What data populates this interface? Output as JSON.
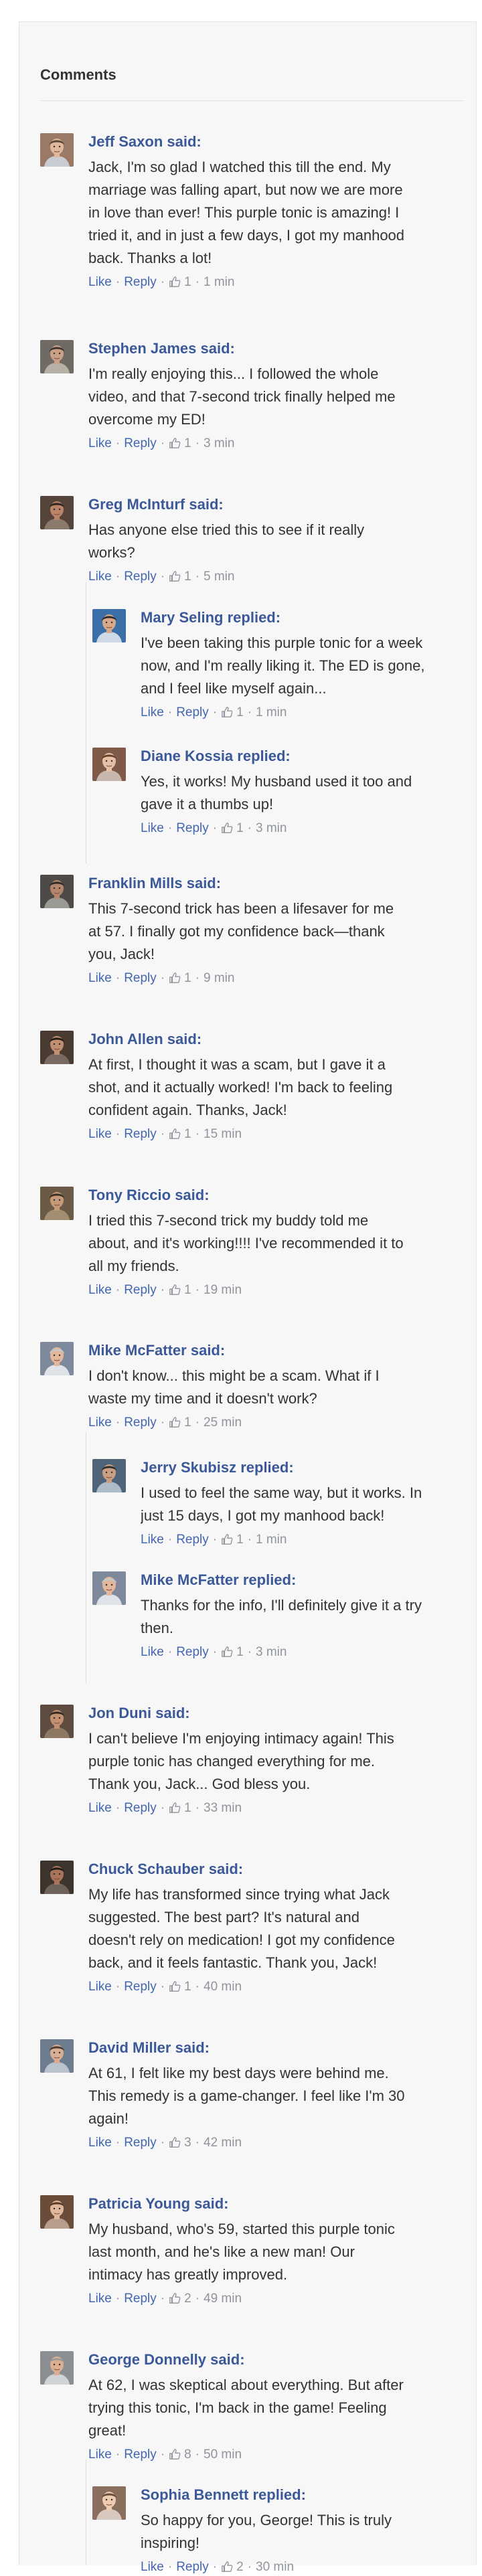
{
  "heading": "Comments",
  "comments": [
    {
      "author": "Jeff Saxon",
      "verb": "said:",
      "lines": "Jack, I'm so glad I watched this till the end. My\nmarriage was falling apart, but now we are more\nin love than ever! This purple tonic is amazing! I\ntried it, and in just a few days, I got my manhood\nback. Thanks a lot!",
      "like": "Like",
      "reply": "Reply",
      "likes": "1",
      "time": "1 min"
    },
    {
      "author": "Stephen James",
      "verb": "said:",
      "lines": "I'm really enjoying this... I followed the whole\nvideo, and that 7-second trick finally helped me\novercome my ED!",
      "like": "Like",
      "reply": "Reply",
      "likes": "1",
      "time": "3 min"
    },
    {
      "author": "Greg McInturf",
      "verb": "said:",
      "lines": "Has anyone else tried this to see if it really\nworks?",
      "like": "Like",
      "reply": "Reply",
      "likes": "1",
      "time": "5 min"
    },
    {
      "author": "Mary Seling",
      "verb": "replied:",
      "lines": "I've been taking this purple tonic for a week\nnow, and I'm really liking it. The ED is gone,\nand I feel like myself again...",
      "like": "Like",
      "reply": "Reply",
      "likes": "1",
      "time": "1 min"
    },
    {
      "author": "Diane Kossia",
      "verb": "replied:",
      "lines": "Yes, it works! My husband used it too and\ngave it a thumbs up!",
      "like": "Like",
      "reply": "Reply",
      "likes": "1",
      "time": "3 min"
    },
    {
      "author": "Franklin Mills",
      "verb": "said:",
      "lines": "This 7-second trick has been a lifesaver for me\nat 57. I finally got my confidence back—thank\nyou, Jack!",
      "like": "Like",
      "reply": "Reply",
      "likes": "1",
      "time": "9 min"
    },
    {
      "author": "John Allen",
      "verb": "said:",
      "lines": "At first, I thought it was a scam, but I gave it a\nshot, and it actually worked! I'm back to feeling\nconfident again. Thanks, Jack!",
      "like": "Like",
      "reply": "Reply",
      "likes": "1",
      "time": "15 min"
    },
    {
      "author": "Tony Riccio",
      "verb": "said:",
      "lines": "I tried this 7-second trick my buddy told me\nabout, and it's working!!!! I've recommended it to\nall my friends.",
      "like": "Like",
      "reply": "Reply",
      "likes": "1",
      "time": "19 min"
    },
    {
      "author": "Mike McFatter",
      "verb": "said:",
      "lines": "I don't know... this might be a scam. What if I\nwaste my time and it doesn't work?",
      "like": "Like",
      "reply": "Reply",
      "likes": "1",
      "time": "25 min"
    },
    {
      "author": "Jerry Skubisz",
      "verb": "replied:",
      "lines": "I used to feel the same way, but it works. In\njust 15 days, I got my manhood back!",
      "like": "Like",
      "reply": "Reply",
      "likes": "1",
      "time": "1 min"
    },
    {
      "author": "Mike McFatter",
      "verb": "replied:",
      "lines": "Thanks for the info, I'll definitely give it a try\nthen.",
      "like": "Like",
      "reply": "Reply",
      "likes": "1",
      "time": "3 min"
    },
    {
      "author": "Jon Duni",
      "verb": "said:",
      "lines": "I can't believe I'm enjoying intimacy again! This\npurple tonic has changed everything for me.\nThank you, Jack... God bless you.",
      "like": "Like",
      "reply": "Reply",
      "likes": "1",
      "time": "33 min"
    },
    {
      "author": "Chuck Schauber",
      "verb": "said:",
      "lines": "My life has transformed since trying what Jack\nsuggested. The best part? It's natural and\ndoesn't rely on medication! I got my confidence\nback, and it feels fantastic. Thank you, Jack!",
      "like": "Like",
      "reply": "Reply",
      "likes": "1",
      "time": "40 min"
    },
    {
      "author": "David Miller",
      "verb": "said:",
      "lines": "At 61, I felt like my best days were behind me.\nThis remedy is a game-changer. I feel like I'm 30\nagain!",
      "like": "Like",
      "reply": "Reply",
      "likes": "3",
      "time": "42 min"
    },
    {
      "author": "Patricia Young",
      "verb": "said:",
      "lines": "My husband, who's 59, started this purple tonic\nlast month, and he's like a new man! Our\nintimacy has greatly improved.",
      "like": "Like",
      "reply": "Reply",
      "likes": "2",
      "time": "49 min"
    },
    {
      "author": "George Donnelly",
      "verb": "said:",
      "lines": "At 62, I was skeptical about everything. But after\ntrying this tonic, I'm back in the game! Feeling\ngreat!",
      "like": "Like",
      "reply": "Reply",
      "likes": "8",
      "time": "50 min"
    },
    {
      "author": "Sophia Bennett",
      "verb": "replied:",
      "lines": "So happy for you, George! This is truly\ninspiring!",
      "like": "Like",
      "reply": "Reply",
      "likes": "2",
      "time": "30 min"
    }
  ]
}
